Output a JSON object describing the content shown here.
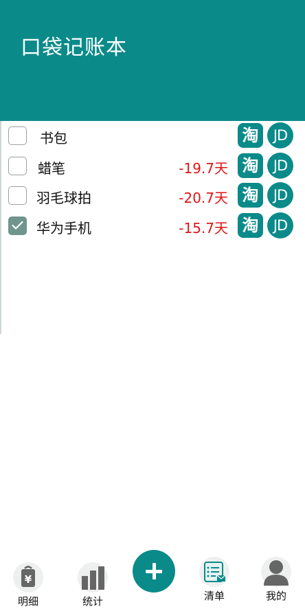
{
  "header": {
    "title": "口袋记账本"
  },
  "list": {
    "items": [
      {
        "name": "书包",
        "days": "",
        "checked": false,
        "tao_label": "淘",
        "jd_label": "JD"
      },
      {
        "name": "蜡笔",
        "days": "-19.7天",
        "checked": false,
        "tao_label": "淘",
        "jd_label": "JD"
      },
      {
        "name": "羽毛球拍",
        "days": "-20.7天",
        "checked": false,
        "tao_label": "淘",
        "jd_label": "JD"
      },
      {
        "name": "华为手机",
        "days": "-15.7天",
        "checked": true,
        "tao_label": "淘",
        "jd_label": "JD"
      }
    ]
  },
  "tabbar": {
    "tabs": [
      {
        "label": "明细",
        "icon": "bag-yen-icon"
      },
      {
        "label": "统计",
        "icon": "bar-chart-icon"
      },
      {
        "label": "清单",
        "icon": "list-mail-icon"
      },
      {
        "label": "我的",
        "icon": "user-icon"
      }
    ],
    "add_icon": "plus-icon"
  },
  "colors": {
    "accent": "#0b8a8a",
    "negative": "#e01515",
    "checked": "#6f958c"
  }
}
